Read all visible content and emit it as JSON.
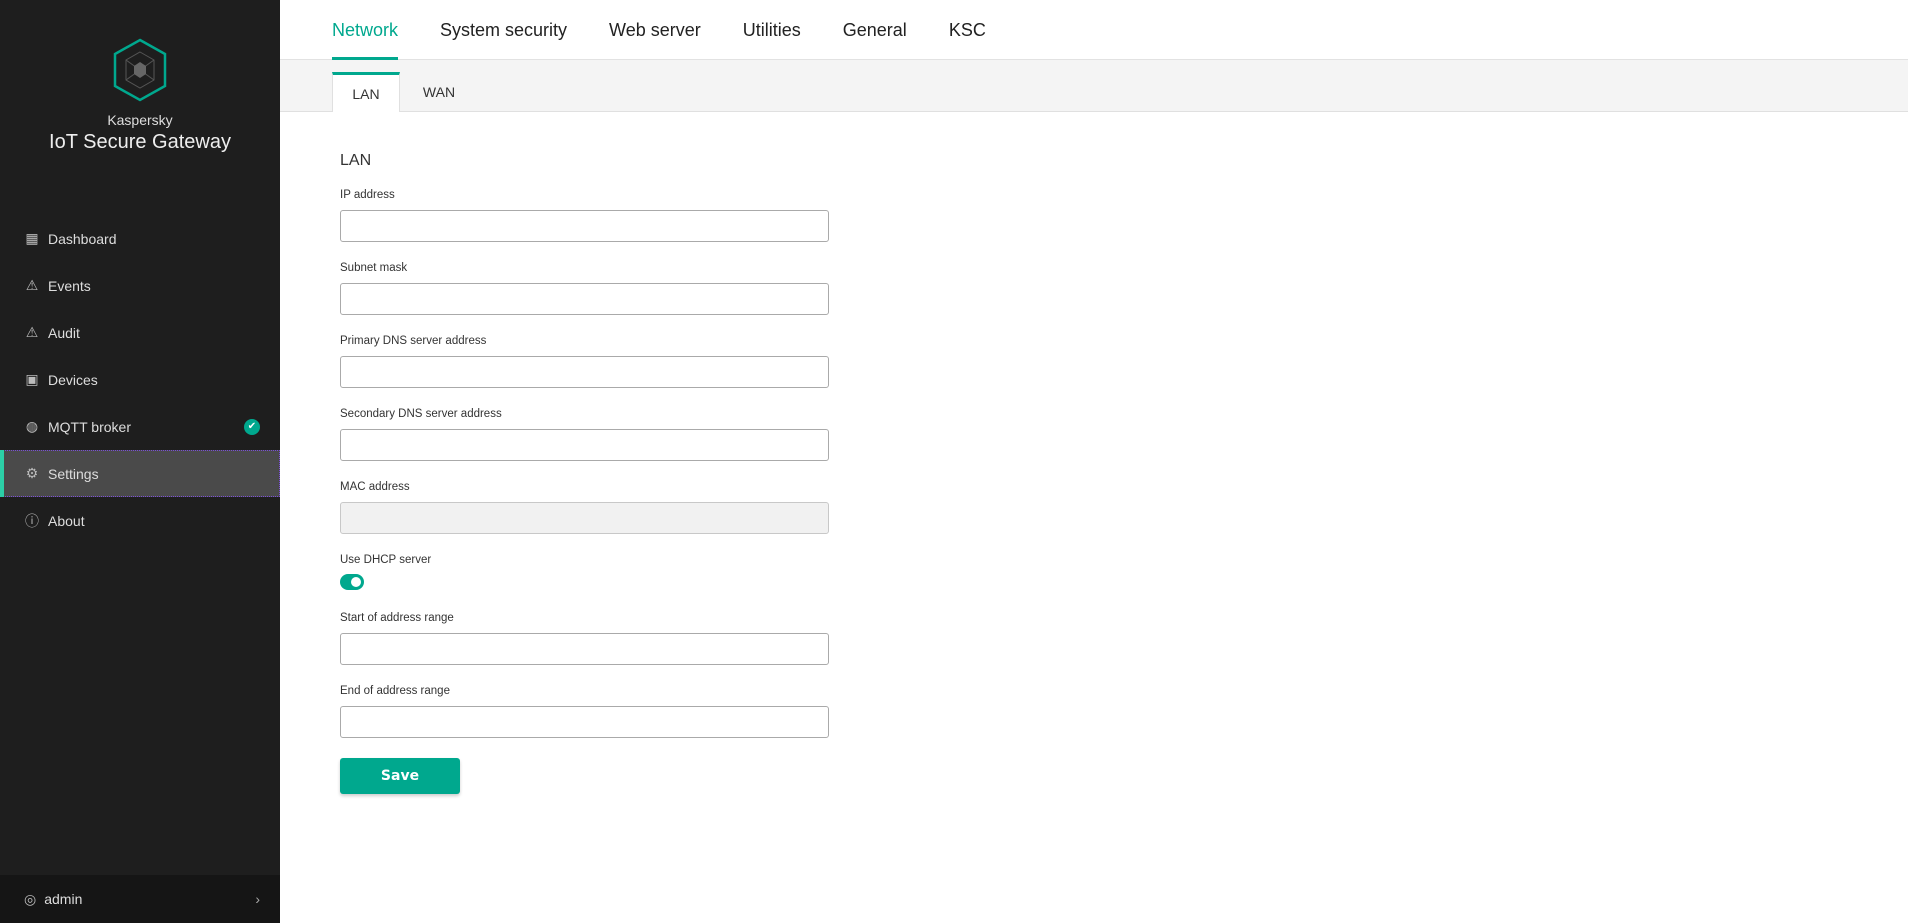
{
  "brand": {
    "company": "Kaspersky",
    "product": "IoT Secure Gateway"
  },
  "sidebar": {
    "items": [
      {
        "label": "Dashboard",
        "icon": "dashboard-icon"
      },
      {
        "label": "Events",
        "icon": "warning-icon"
      },
      {
        "label": "Audit",
        "icon": "audit-icon"
      },
      {
        "label": "Devices",
        "icon": "devices-icon"
      },
      {
        "label": "MQTT broker",
        "icon": "globe-icon",
        "status": "ok"
      },
      {
        "label": "Settings",
        "icon": "gear-icon",
        "active": true
      },
      {
        "label": "About",
        "icon": "info-icon"
      }
    ],
    "user": "admin"
  },
  "tabs": [
    "Network",
    "System security",
    "Web server",
    "Utilities",
    "General",
    "KSC"
  ],
  "subtabs": [
    "LAN",
    "WAN"
  ],
  "form": {
    "heading": "LAN",
    "ip_label": "IP address",
    "ip_value": "",
    "subnet_label": "Subnet mask",
    "subnet_value": "",
    "dns1_label": "Primary DNS server address",
    "dns1_value": "",
    "dns2_label": "Secondary DNS server address",
    "dns2_value": "",
    "mac_label": "MAC address",
    "mac_value": "",
    "dhcp_label": "Use DHCP server",
    "dhcp_enabled": true,
    "start_label": "Start of address range",
    "start_value": "",
    "end_label": "End of address range",
    "end_value": "",
    "save": "Save"
  },
  "colors": {
    "accent": "#00a88e",
    "sidebar": "#1e1e1e"
  }
}
